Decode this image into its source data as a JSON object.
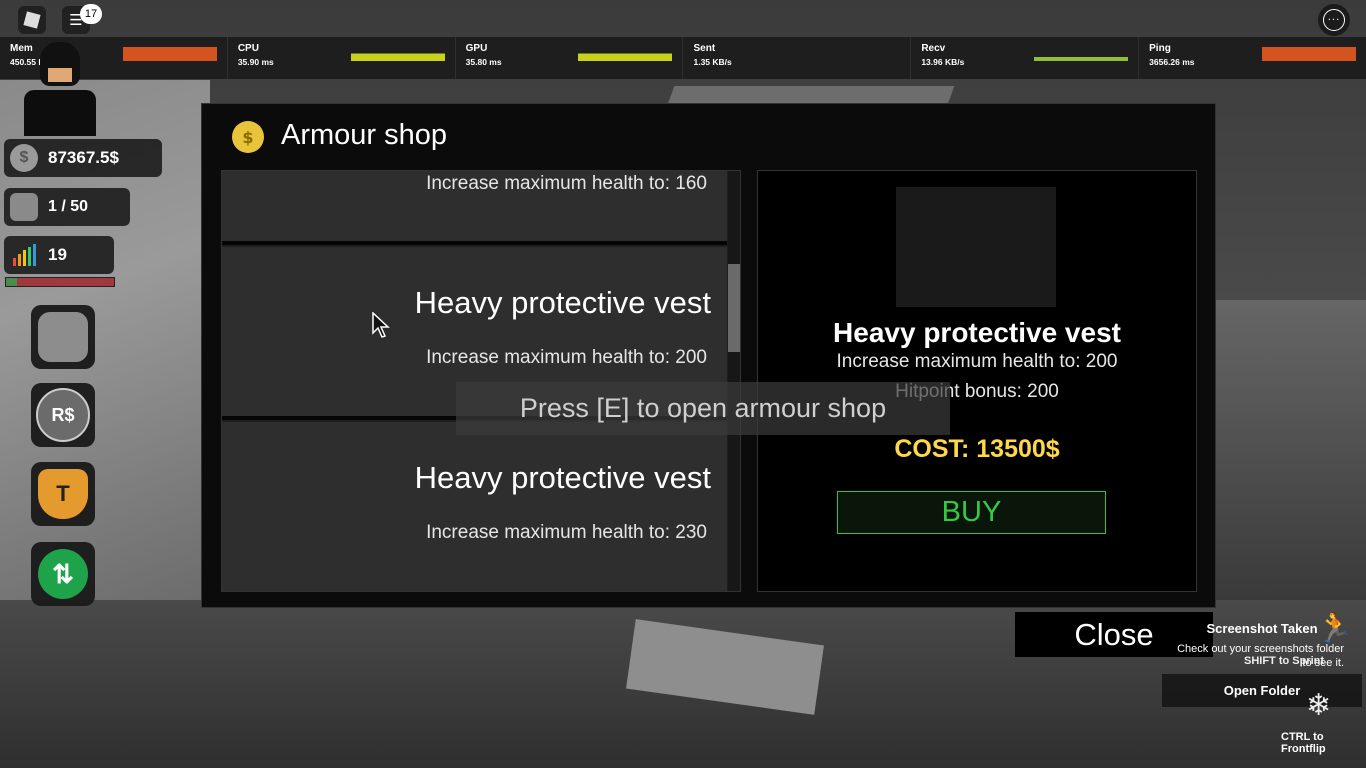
{
  "topbar": {
    "chat_badge": "17"
  },
  "stats": [
    {
      "label": "Mem",
      "value": "450.55 MB",
      "bar": "orange"
    },
    {
      "label": "CPU",
      "value": "35.90 ms",
      "bar": "yellow"
    },
    {
      "label": "GPU",
      "value": "35.80 ms",
      "bar": "yellow"
    },
    {
      "label": "Sent",
      "value": "1.35 KB/s",
      "bar": "none"
    },
    {
      "label": "Recv",
      "value": "13.96 KB/s",
      "bar": "spark"
    },
    {
      "label": "Ping",
      "value": "3656.26 ms",
      "bar": "orange"
    }
  ],
  "hud": {
    "money": "87367.5$",
    "inventory": "1 / 50",
    "level": "19",
    "xp_fraction": 0.1,
    "buttons": [
      "backpack-icon",
      "robux-icon",
      "shield-t-icon",
      "refresh-icon"
    ],
    "robux_symbol": "R$",
    "shield_letter": "T"
  },
  "shop": {
    "title": "Armour shop",
    "items": [
      {
        "name": "",
        "desc": "Increase maximum health to: 160"
      },
      {
        "name": "Heavy protective vest",
        "desc": "Increase maximum health to: 200"
      },
      {
        "name": "Heavy protective vest",
        "desc": "Increase maximum health to: 230"
      }
    ],
    "selected": {
      "name": "Heavy protective vest",
      "desc": "Increase maximum health to: 200",
      "bonus": "Hitpoint bonus: 200",
      "cost": "COST: 13500$",
      "buy_label": "BUY"
    }
  },
  "prompt": "Press [E] to open armour shop",
  "close_label": "Close",
  "toast": {
    "title": "Screenshot Taken",
    "body_line1": "Check out your screenshots folder",
    "body_line2": "to see it.",
    "open_folder": "Open Folder"
  },
  "tips": {
    "sprint": "SHIFT to Sprint",
    "frontflip": "CTRL to Frontflip"
  },
  "colors": {
    "accent_buy": "#36c844",
    "cost": "#ffd84a",
    "stat_orange": "#d4541f",
    "stat_yellow": "#c7d31a"
  }
}
